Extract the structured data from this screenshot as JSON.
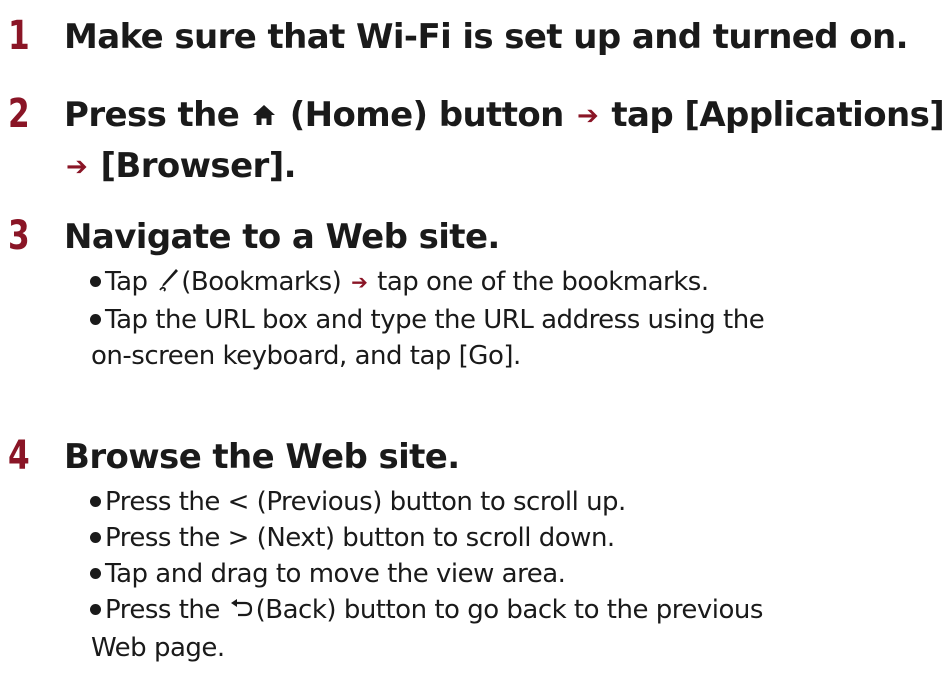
{
  "steps": [
    {
      "number": "1",
      "title": "Make sure that Wi-Fi is set up and turned on."
    },
    {
      "number": "2",
      "title_parts": {
        "a": "Press the",
        "b": "(Home) button",
        "c": "tap [Applications]",
        "d": "[Browser]."
      }
    },
    {
      "number": "3",
      "title": "Navigate to a Web site.",
      "bullets": [
        {
          "a": "Tap",
          "b": "(Bookmarks)",
          "c": "tap one of the bookmarks."
        },
        {
          "line1": "Tap the URL box and type the URL address using the",
          "line2": "on-screen keyboard, and tap [Go]."
        }
      ]
    },
    {
      "number": "4",
      "title": "Browse the Web site.",
      "bullets": [
        {
          "text": "Press the < (Previous) button to scroll up."
        },
        {
          "text": "Press the > (Next) button to scroll down."
        },
        {
          "text": "Tap and drag to move the view area."
        },
        {
          "a": "Press the",
          "b": "(Back) button to go back to the previous",
          "line2": "Web page."
        }
      ]
    }
  ],
  "icons": {
    "arrow": "right-arrow-icon",
    "home": "home-icon",
    "bookmarks": "bookmarks-pen-icon",
    "back": "back-arrow-icon"
  },
  "colors": {
    "step_number": "#8a1526",
    "arrow": "#8a1526",
    "text": "#1a1a1a"
  }
}
